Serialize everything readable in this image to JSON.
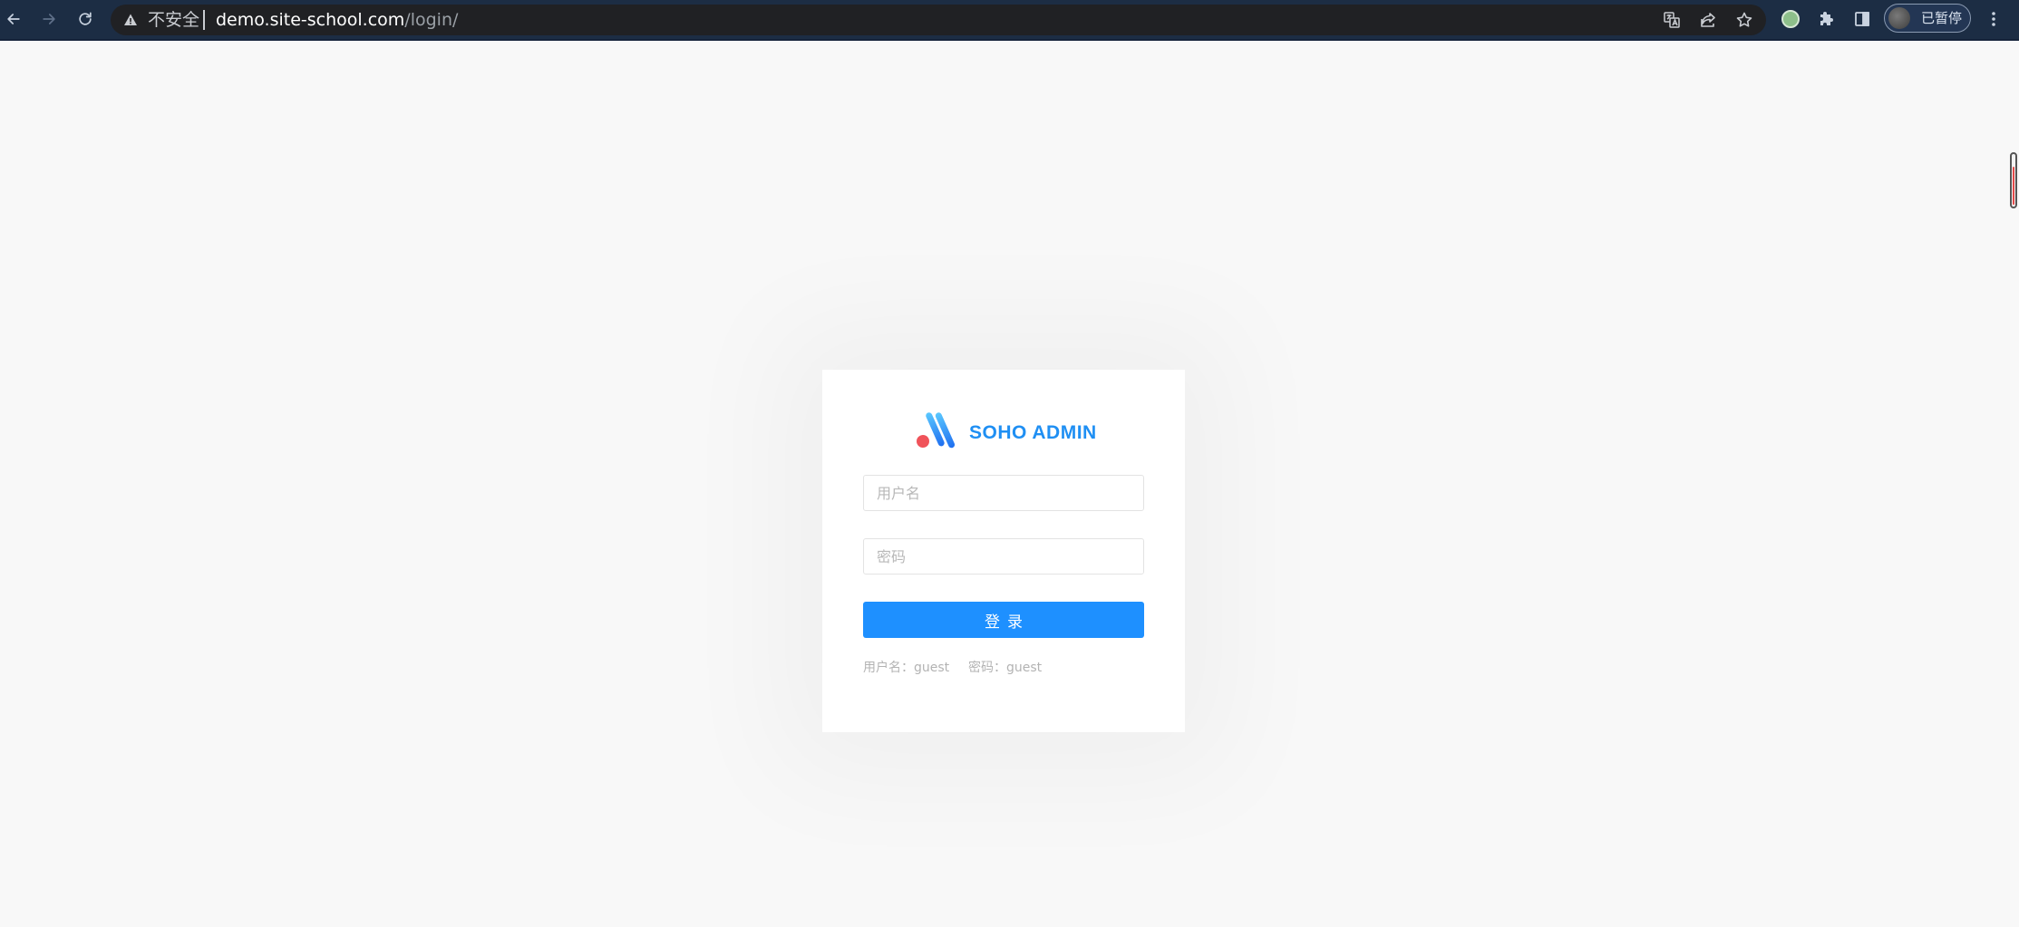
{
  "browser": {
    "security_label": "不安全",
    "url_host": "demo.site-school.com",
    "url_path": "/login/",
    "profile_label": "已暂停",
    "icons": {
      "back": "back-arrow-icon",
      "forward": "forward-arrow-icon",
      "reload": "reload-icon",
      "warning": "warning-icon",
      "translate": "translate-icon",
      "share": "share-icon",
      "bookmark": "star-icon",
      "extension_status": "extension-status-icon",
      "extensions": "puzzle-icon",
      "side_panel": "side-panel-icon",
      "menu": "more-vertical-icon"
    }
  },
  "login": {
    "brand": "SOHO ADMIN",
    "username_placeholder": "用户名",
    "password_placeholder": "密码",
    "submit_label": "登录",
    "hint_username": "用户名：guest",
    "hint_password": "密码：guest"
  },
  "colors": {
    "accent": "#1e90ff",
    "logo_dot": "#f0535a",
    "page_background": "#f8f8f8",
    "toolbar": "#1c2d44"
  }
}
